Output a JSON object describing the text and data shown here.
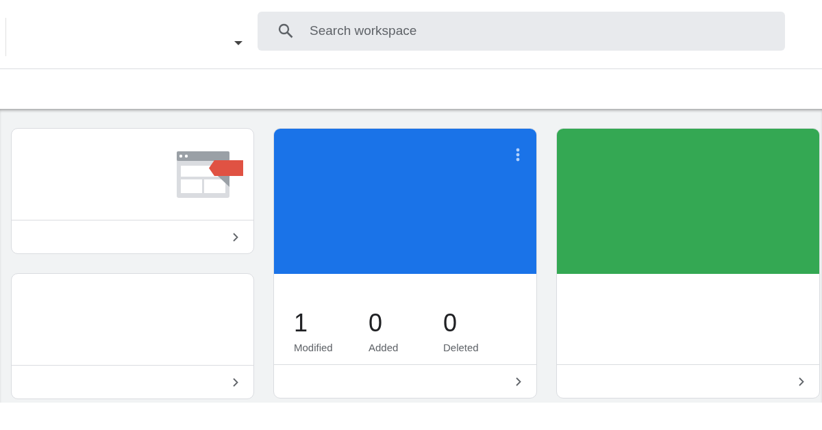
{
  "search": {
    "placeholder": "Search workspace"
  },
  "side_cards": [
    {
      "kind": "illustrated"
    },
    {
      "kind": "plain"
    }
  ],
  "workspace_cards": [
    {
      "color": "#1a73e8",
      "menu": true,
      "stats": [
        {
          "value": "1",
          "label": "Modified"
        },
        {
          "value": "0",
          "label": "Added"
        },
        {
          "value": "0",
          "label": "Deleted"
        }
      ]
    },
    {
      "color": "#34a853",
      "menu": false
    }
  ]
}
